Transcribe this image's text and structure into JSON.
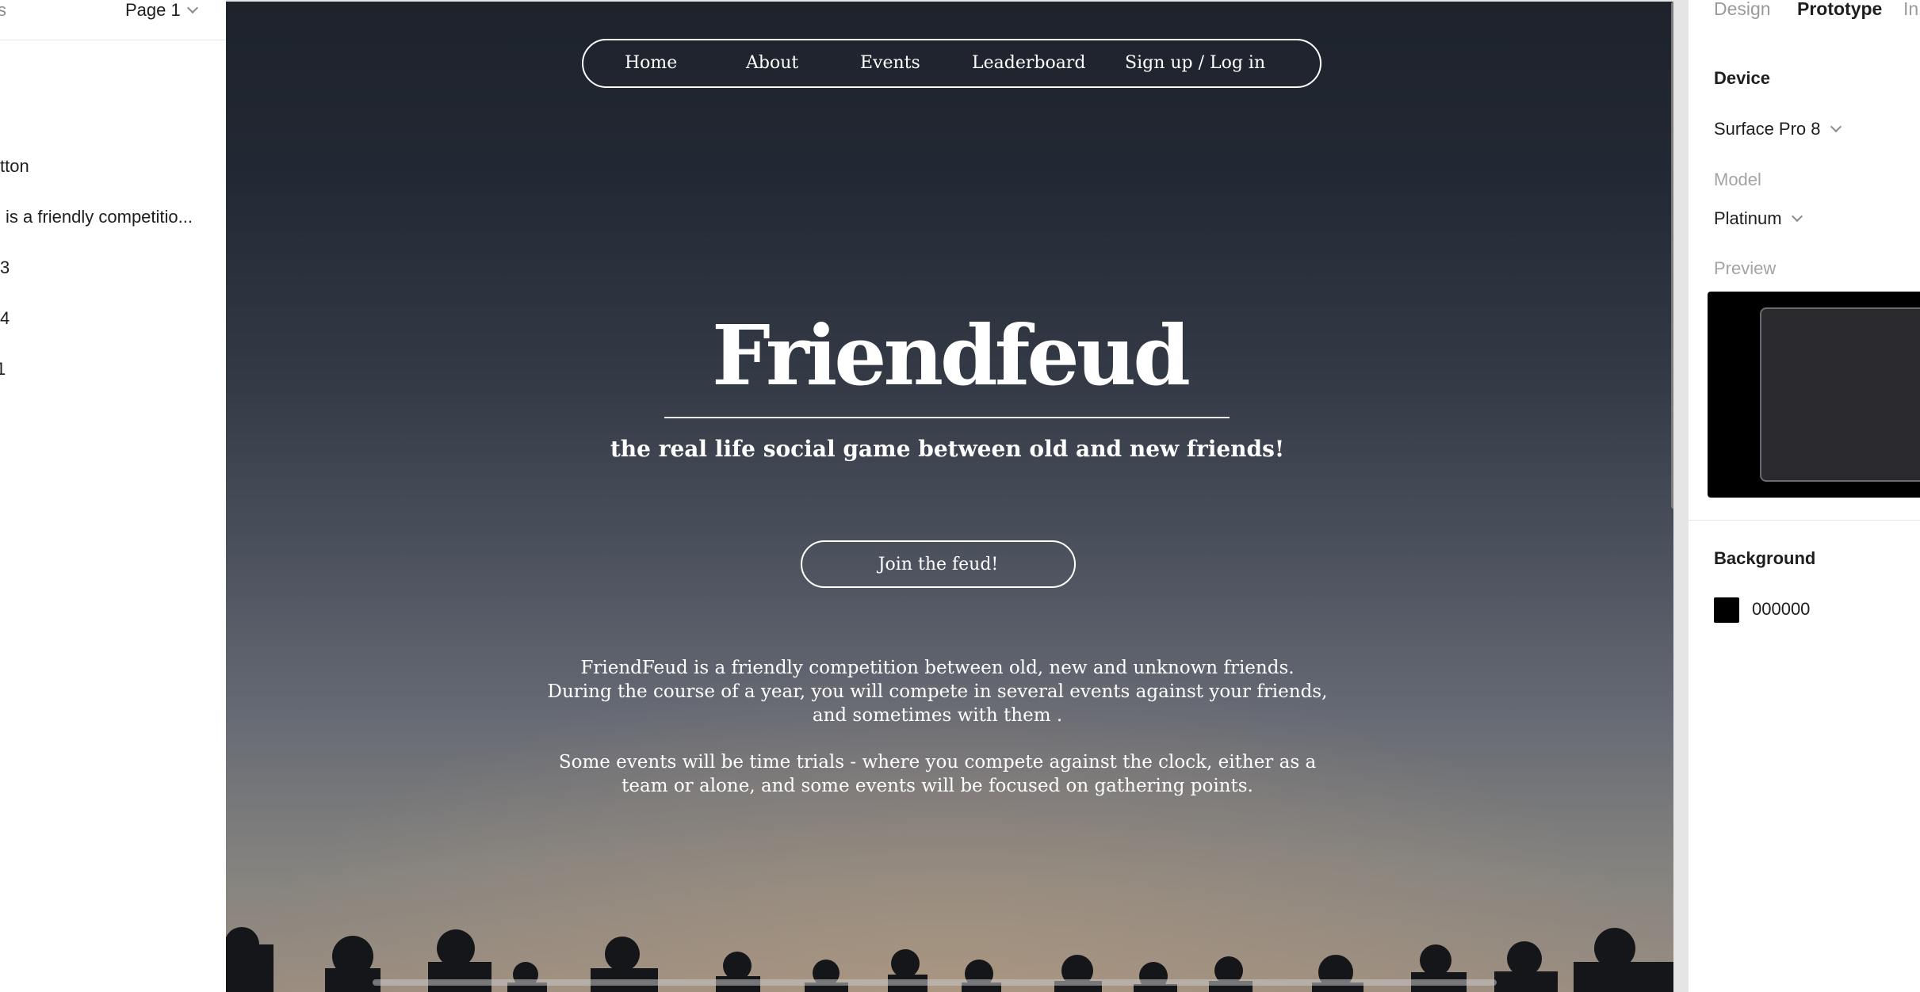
{
  "left_panel": {
    "tab_partial": "s",
    "page_selector": "Page 1",
    "layers": [
      "tton",
      "is a friendly competitio...",
      "3",
      "4",
      "1"
    ]
  },
  "frame": {
    "nav": [
      "Home",
      "About",
      "Events",
      "Leaderboard",
      "Sign up / Log in"
    ],
    "title": "Friendfeud",
    "subtitle": "the real life social game between old and new friends!",
    "cta": "Join the feud!",
    "paragraph1": [
      "FriendFeud is a friendly competition between  old, new and unknown friends.",
      "During the course of a year, you will compete in several events against your friends,",
      "and sometimes with them ."
    ],
    "paragraph2": [
      "Some events will be time trials - where you compete against the clock, either as a",
      "team or alone, and some events will be focused on gathering points."
    ]
  },
  "right_panel": {
    "tabs": [
      "Design",
      "Prototype",
      "In"
    ],
    "device_title": "Device",
    "device_value": "Surface Pro 8",
    "model_label": "Model",
    "model_value": "Platinum",
    "preview_label": "Preview",
    "background_title": "Background",
    "background_value": "000000"
  },
  "colors": {
    "frame_background": "#000000",
    "accent_text": "#ffffff"
  }
}
